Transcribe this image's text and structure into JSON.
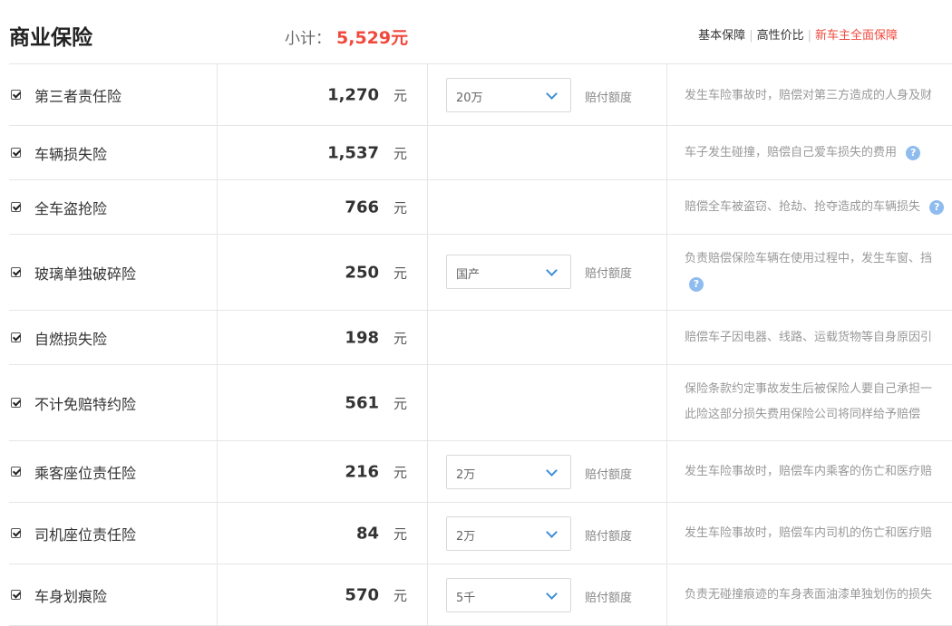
{
  "header": {
    "title": "商业保险",
    "subtotal_label": "小计：",
    "subtotal_value": "5,529元",
    "plans": [
      "基本保障",
      "高性价比",
      "新车主全面保障"
    ],
    "active_plan_color": "#f0493e"
  },
  "rows": [
    {
      "checked": true,
      "name": "第三者责任险",
      "price": "1,270",
      "unit": "元",
      "select": "20万",
      "hint": "赔付额度",
      "desc": [
        "发生车险事故时，赔偿对第三方造成的人身及财"
      ]
    },
    {
      "checked": true,
      "name": "车辆损失险",
      "price": "1,537",
      "unit": "元",
      "desc": [
        "车子发生碰撞，赔偿自己爱车损失的费用"
      ],
      "help": "?"
    },
    {
      "checked": true,
      "name": "全车盗抢险",
      "price": "766",
      "unit": "元",
      "desc": [
        "赔偿全车被盗窃、抢劫、抢夺造成的车辆损失"
      ],
      "help": "?"
    },
    {
      "checked": true,
      "name": "玻璃单独破碎险",
      "price": "250",
      "unit": "元",
      "select": "国产",
      "hint": "赔付额度",
      "desc": [
        "负责赔偿保险车辆在使用过程中，发生车窗、挡"
      ],
      "help": "?"
    },
    {
      "checked": true,
      "name": "自燃损失险",
      "price": "198",
      "unit": "元",
      "desc": [
        "赔偿车子因电器、线路、运载货物等自身原因引"
      ]
    },
    {
      "checked": true,
      "name": "不计免赔特约险",
      "price": "561",
      "unit": "元",
      "desc": [
        "保险条款约定事故发生后被保险人要自己承担一",
        "此险这部分损失费用保险公司将同样给予赔偿"
      ]
    },
    {
      "checked": true,
      "name": "乘客座位责任险",
      "price": "216",
      "unit": "元",
      "select": "2万",
      "hint": "赔付额度",
      "desc": [
        "发生车险事故时，赔偿车内乘客的伤亡和医疗赔"
      ]
    },
    {
      "checked": true,
      "name": "司机座位责任险",
      "price": "84",
      "unit": "元",
      "select": "2万",
      "hint": "赔付额度",
      "desc": [
        "发生车险事故时，赔偿车内司机的伤亡和医疗赔"
      ]
    },
    {
      "checked": true,
      "name": "车身划痕险",
      "price": "570",
      "unit": "元",
      "select": "5千",
      "hint": "赔付额度",
      "desc": [
        "负责无碰撞痕迹的车身表面油漆单独划伤的损失"
      ]
    }
  ]
}
